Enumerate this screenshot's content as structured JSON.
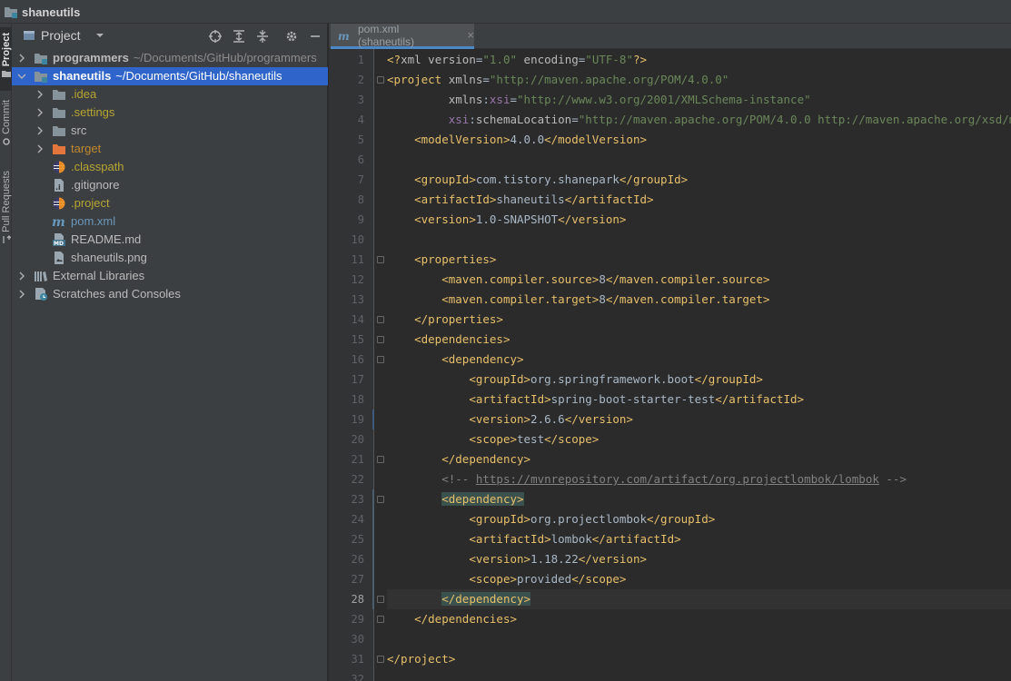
{
  "titlebar": {
    "project": "shaneutils"
  },
  "stripe": {
    "tabs": [
      "Project",
      "Commit",
      "Pull Requests"
    ]
  },
  "project_panel": {
    "title": "Project",
    "items": [
      {
        "name": "programmers",
        "path": "~/Documents/GitHub/programmers",
        "bold": true,
        "depth": 0,
        "icon": "module-folder-icon",
        "arrow": "right"
      },
      {
        "name": "shaneutils",
        "path": "~/Documents/GitHub/shaneutils",
        "bold": true,
        "depth": 0,
        "icon": "module-folder-icon",
        "arrow": "down",
        "selected": true
      },
      {
        "name": ".idea",
        "depth": 1,
        "icon": "folder-icon",
        "arrow": "right",
        "color": "#b7a531"
      },
      {
        "name": ".settings",
        "depth": 1,
        "icon": "folder-icon",
        "arrow": "right",
        "color": "#b7a531"
      },
      {
        "name": "src",
        "depth": 1,
        "icon": "folder-icon",
        "arrow": "right"
      },
      {
        "name": "target",
        "depth": 1,
        "icon": "excluded-folder-icon",
        "arrow": "right",
        "color": "#c0882e"
      },
      {
        "name": ".classpath",
        "depth": 1,
        "icon": "eclipse-file-icon",
        "color": "#b7a531"
      },
      {
        "name": ".gitignore",
        "depth": 1,
        "icon": "ignore-file-icon"
      },
      {
        "name": ".project",
        "depth": 1,
        "icon": "eclipse-file-icon",
        "color": "#b7a531"
      },
      {
        "name": "pom.xml",
        "depth": 1,
        "icon": "maven-file-icon",
        "color": "#6897bb"
      },
      {
        "name": "README.md",
        "depth": 1,
        "icon": "markdown-file-icon"
      },
      {
        "name": "shaneutils.png",
        "depth": 1,
        "icon": "image-file-icon"
      },
      {
        "name": "External Libraries",
        "depth": 0,
        "icon": "libraries-icon",
        "arrow": "right"
      },
      {
        "name": "Scratches and Consoles",
        "depth": 0,
        "icon": "scratches-icon",
        "arrow": "right"
      }
    ]
  },
  "editor": {
    "tab_label": "pom.xml (shaneutils)",
    "current_line": 28,
    "lines": [
      [
        [
          "t",
          "<?"
        ],
        [
          "an",
          "xml version"
        ],
        [
          "tx",
          "="
        ],
        [
          "v",
          "\"1.0\""
        ],
        [
          "an",
          " encoding"
        ],
        [
          "tx",
          "="
        ],
        [
          "v",
          "\"UTF-8\""
        ],
        [
          "t",
          "?>"
        ]
      ],
      [
        [
          "t",
          "<project "
        ],
        [
          "an",
          "xmlns"
        ],
        [
          "tx",
          "="
        ],
        [
          "v",
          "\"http://maven.apache.org/POM/4.0.0\""
        ]
      ],
      [
        [
          "tx",
          "         "
        ],
        [
          "an",
          "xmlns"
        ],
        [
          "tx",
          ":"
        ],
        [
          "ns",
          "xsi"
        ],
        [
          "tx",
          "="
        ],
        [
          "v",
          "\"http://www.w3.org/2001/XMLSchema-instance\""
        ]
      ],
      [
        [
          "tx",
          "         "
        ],
        [
          "ns",
          "xsi"
        ],
        [
          "tx",
          ":"
        ],
        [
          "an",
          "schemaLocation"
        ],
        [
          "tx",
          "="
        ],
        [
          "v",
          "\"http://maven.apache.org/POM/4.0.0 http://maven.apache.org/xsd/maven-4.0.0.xsd\""
        ]
      ],
      [
        [
          "tx",
          "    "
        ],
        [
          "t",
          "<modelVersion>"
        ],
        [
          "tx",
          "4.0.0"
        ],
        [
          "t",
          "</modelVersion>"
        ]
      ],
      [],
      [
        [
          "tx",
          "    "
        ],
        [
          "t",
          "<groupId>"
        ],
        [
          "tx",
          "com.tistory.shanepark"
        ],
        [
          "t",
          "</groupId>"
        ]
      ],
      [
        [
          "tx",
          "    "
        ],
        [
          "t",
          "<artifactId>"
        ],
        [
          "tx",
          "shaneutils"
        ],
        [
          "t",
          "</artifactId>"
        ]
      ],
      [
        [
          "tx",
          "    "
        ],
        [
          "t",
          "<version>"
        ],
        [
          "tx",
          "1.0-SNAPSHOT"
        ],
        [
          "t",
          "</version>"
        ]
      ],
      [],
      [
        [
          "tx",
          "    "
        ],
        [
          "t",
          "<properties>"
        ]
      ],
      [
        [
          "tx",
          "        "
        ],
        [
          "t",
          "<maven.compiler.source>"
        ],
        [
          "tx",
          "8"
        ],
        [
          "t",
          "</maven.compiler.source>"
        ]
      ],
      [
        [
          "tx",
          "        "
        ],
        [
          "t",
          "<maven.compiler.target>"
        ],
        [
          "tx",
          "8"
        ],
        [
          "t",
          "</maven.compiler.target>"
        ]
      ],
      [
        [
          "tx",
          "    "
        ],
        [
          "t",
          "</properties>"
        ]
      ],
      [
        [
          "tx",
          "    "
        ],
        [
          "t",
          "<dependencies>"
        ]
      ],
      [
        [
          "tx",
          "        "
        ],
        [
          "t",
          "<dependency>"
        ]
      ],
      [
        [
          "tx",
          "            "
        ],
        [
          "t",
          "<groupId>"
        ],
        [
          "tx",
          "org.springframework.boot"
        ],
        [
          "t",
          "</groupId>"
        ]
      ],
      [
        [
          "tx",
          "            "
        ],
        [
          "t",
          "<artifactId>"
        ],
        [
          "tx",
          "spring-boot-starter-test"
        ],
        [
          "t",
          "</artifactId>"
        ]
      ],
      [
        [
          "tx",
          "            "
        ],
        [
          "t",
          "<version>"
        ],
        [
          "tx",
          "2.6.6"
        ],
        [
          "t",
          "</version>"
        ]
      ],
      [
        [
          "tx",
          "            "
        ],
        [
          "t",
          "<scope>"
        ],
        [
          "tx",
          "test"
        ],
        [
          "t",
          "</scope>"
        ]
      ],
      [
        [
          "tx",
          "        "
        ],
        [
          "t",
          "</dependency>"
        ]
      ],
      [
        [
          "tx",
          "        "
        ],
        [
          "cm",
          "<!-- "
        ],
        [
          "lnk",
          "https://mvnrepository.com/artifact/org.projectlombok/lombok"
        ],
        [
          "cm",
          " -->"
        ]
      ],
      [
        [
          "tx",
          "        "
        ],
        [
          "t mh",
          "<dependency>"
        ]
      ],
      [
        [
          "tx",
          "            "
        ],
        [
          "t",
          "<groupId>"
        ],
        [
          "tx",
          "org.projectlombok"
        ],
        [
          "t",
          "</groupId>"
        ]
      ],
      [
        [
          "tx",
          "            "
        ],
        [
          "t",
          "<artifactId>"
        ],
        [
          "tx",
          "lombok"
        ],
        [
          "t",
          "</artifactId>"
        ]
      ],
      [
        [
          "tx",
          "            "
        ],
        [
          "t",
          "<version>"
        ],
        [
          "tx",
          "1.18.22"
        ],
        [
          "t",
          "</version>"
        ]
      ],
      [
        [
          "tx",
          "            "
        ],
        [
          "t",
          "<scope>"
        ],
        [
          "tx",
          "provided"
        ],
        [
          "t",
          "</scope>"
        ]
      ],
      [
        [
          "tx",
          "        "
        ],
        [
          "t mh",
          "</dependency>"
        ]
      ],
      [
        [
          "tx",
          "    "
        ],
        [
          "t",
          "</dependencies>"
        ]
      ],
      [],
      [
        [
          "t",
          "</project>"
        ]
      ],
      []
    ]
  }
}
